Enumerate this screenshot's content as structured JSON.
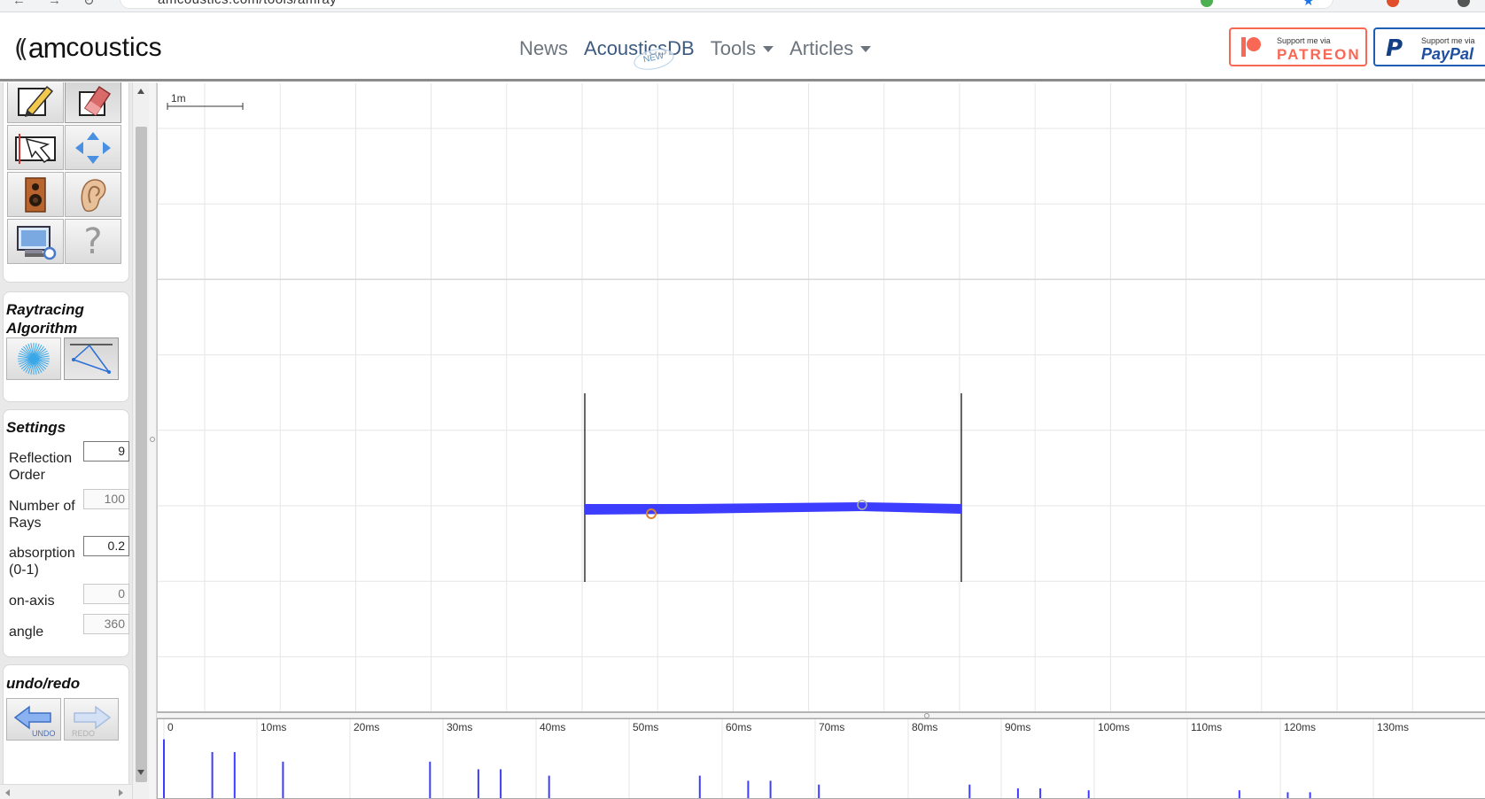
{
  "browser": {
    "url": "amcoustics.com/tools/amray"
  },
  "header": {
    "logo_waves": "((",
    "logo_am": "am",
    "logo_rest": "coustics",
    "nav": [
      {
        "label": "News"
      },
      {
        "label": "AcousticsDB",
        "badge": "NEW"
      },
      {
        "label": "Tools"
      },
      {
        "label": "Articles"
      }
    ],
    "patreon": {
      "small": "Support me via",
      "big": "PATREON"
    },
    "paypal": {
      "small": "Support me via",
      "big": "PayPal",
      "mark": "P"
    }
  },
  "toolbar": {
    "tools": [
      {
        "name": "draw-tool-button",
        "icon": "pencil-icon"
      },
      {
        "name": "erase-tool-button",
        "icon": "eraser-icon"
      },
      {
        "name": "select-tool-button",
        "icon": "selection-arrow-icon"
      },
      {
        "name": "move-tool-button",
        "icon": "move-arrows-icon"
      },
      {
        "name": "source-tool-button",
        "icon": "speaker-icon"
      },
      {
        "name": "receiver-tool-button",
        "icon": "ear-icon"
      },
      {
        "name": "settings-tool-button",
        "icon": "computer-wrench-icon"
      },
      {
        "name": "help-tool-button",
        "icon": "question-mark-icon",
        "glyph": "?"
      }
    ],
    "raytracing": {
      "title_line1": "Raytracing",
      "title_line2": "Algorithm",
      "options": [
        {
          "name": "raytrace-mode-button",
          "icon": "ray-burst-icon"
        },
        {
          "name": "mirror-image-mode-button",
          "icon": "image-source-icon"
        }
      ]
    },
    "settings": {
      "title": "Settings",
      "fields": [
        {
          "label1": "Reflection",
          "label2": "Order",
          "value": "9",
          "enabled": true
        },
        {
          "label1": "Number of",
          "label2": "Rays",
          "value": "100",
          "enabled": false
        },
        {
          "label1": "absorption",
          "label2": "(0-1)",
          "value": "0.2",
          "enabled": true
        },
        {
          "label1": "on-axis",
          "label2": "",
          "value": "0",
          "enabled": false
        },
        {
          "label1": "angle",
          "label2": "",
          "value": "360",
          "enabled": false
        }
      ]
    },
    "undo_redo": {
      "title": "undo/redo",
      "undo_label": "UNDO",
      "redo_label": "REDO"
    }
  },
  "canvas": {
    "scale_label": "1m",
    "colors": {
      "ray": "#3d3dff",
      "wall": "#333333",
      "source": "#d9822b",
      "receiver": "#999999",
      "grid": "#e6e6e6"
    }
  },
  "echogram": {
    "time_labels": [
      "0",
      "10ms",
      "20ms",
      "30ms",
      "40ms",
      "50ms",
      "60ms",
      "70ms",
      "80ms",
      "90ms",
      "100ms",
      "110ms",
      "120ms",
      "130ms"
    ],
    "reflections": [
      {
        "t_ms": 0.0,
        "level": 0.95
      },
      {
        "t_ms": 5.2,
        "level": 0.75
      },
      {
        "t_ms": 7.6,
        "level": 0.75
      },
      {
        "t_ms": 12.8,
        "level": 0.6
      },
      {
        "t_ms": 28.6,
        "level": 0.6
      },
      {
        "t_ms": 33.8,
        "level": 0.48
      },
      {
        "t_ms": 36.2,
        "level": 0.48
      },
      {
        "t_ms": 41.4,
        "level": 0.38
      },
      {
        "t_ms": 57.6,
        "level": 0.38
      },
      {
        "t_ms": 62.8,
        "level": 0.3
      },
      {
        "t_ms": 65.2,
        "level": 0.3
      },
      {
        "t_ms": 70.4,
        "level": 0.24
      },
      {
        "t_ms": 86.6,
        "level": 0.24
      },
      {
        "t_ms": 91.8,
        "level": 0.18
      },
      {
        "t_ms": 94.2,
        "level": 0.18
      },
      {
        "t_ms": 99.4,
        "level": 0.15
      },
      {
        "t_ms": 115.6,
        "level": 0.15
      },
      {
        "t_ms": 120.8,
        "level": 0.12
      },
      {
        "t_ms": 123.2,
        "level": 0.12
      }
    ]
  }
}
